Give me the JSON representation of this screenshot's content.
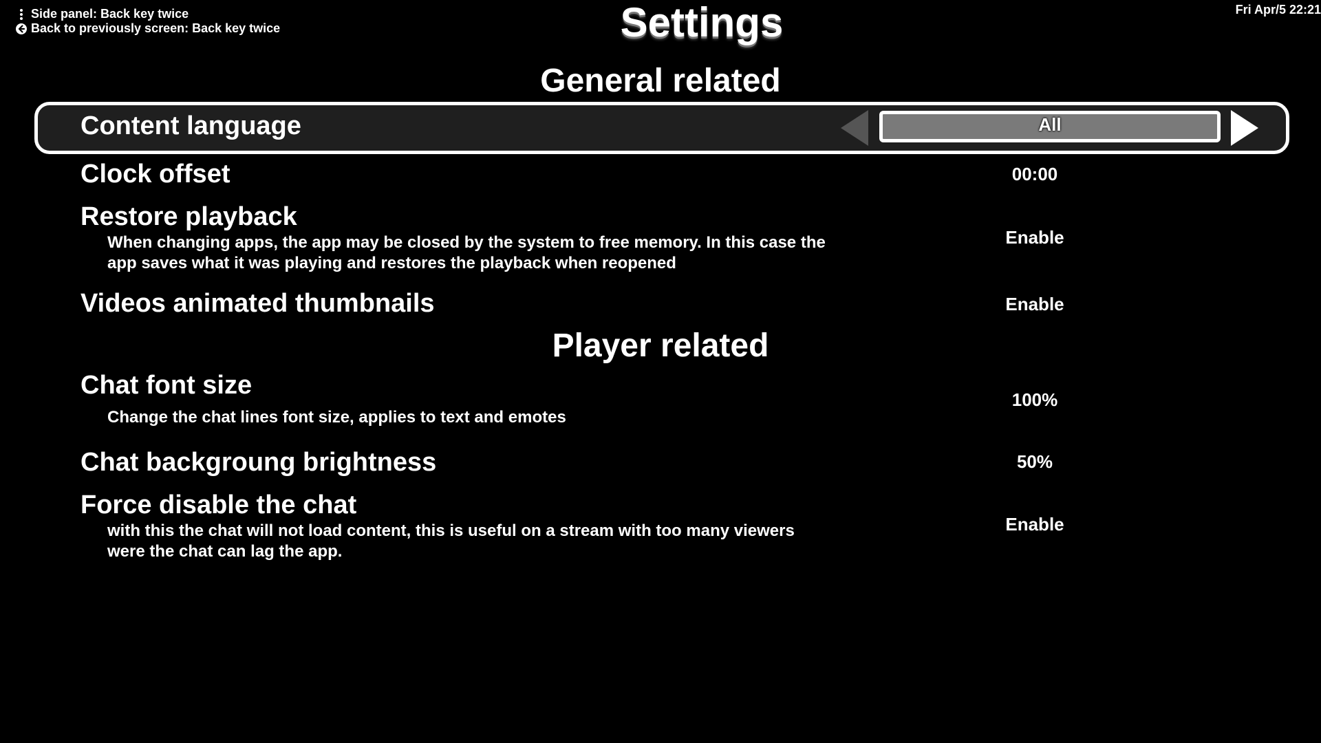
{
  "header": {
    "hint_side_panel": "Side panel: Back key twice",
    "hint_back": "Back to previously screen: Back key twice",
    "title": "Settings",
    "clock": "Fri Apr/5 22:21"
  },
  "icons": {
    "side_panel": "vertical-dots-icon",
    "back": "back-arrow-circle-icon",
    "option_prev": "triangle-left-icon",
    "option_next": "triangle-right-icon"
  },
  "sections": {
    "general": "General related",
    "player": "Player related"
  },
  "settings": {
    "content_language": {
      "name": "Content language",
      "value": "All"
    },
    "clock_offset": {
      "name": "Clock offset",
      "value": "00:00"
    },
    "restore_playback": {
      "name": "Restore playback",
      "description": "When changing apps, the app may be closed by the system to free memory. In this case the app saves what it was playing and restores the playback when reopened",
      "value": "Enable"
    },
    "animated_thumbnails": {
      "name": "Videos animated thumbnails",
      "value": "Enable"
    },
    "chat_font_size": {
      "name": "Chat font size",
      "description": "Change the chat lines font size, applies to text and emotes",
      "value": "100%"
    },
    "chat_brightness": {
      "name": "Chat backgroung brightness",
      "value": "50%"
    },
    "force_disable_chat": {
      "name": "Force disable the chat",
      "description": "with this the chat will not load content, this is useful on a stream with too many viewers were the chat can lag the app.",
      "value": "Enable"
    }
  },
  "colors": {
    "background": "#000000",
    "text": "#ffffff",
    "selected_row": "#1f1f1f",
    "value_box": "#7a7a7a",
    "arrow_disabled": "#555555"
  }
}
